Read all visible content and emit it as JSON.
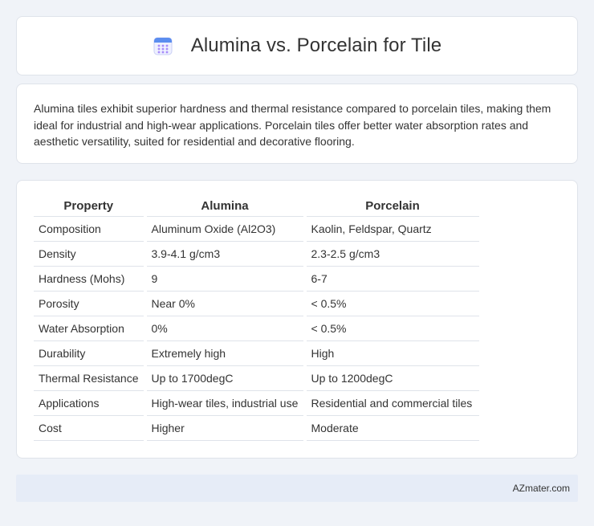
{
  "header": {
    "icon": "calendar-icon",
    "title": "Alumina vs. Porcelain for Tile"
  },
  "summary": {
    "text": "Alumina tiles exhibit superior hardness and thermal resistance compared to porcelain tiles, making them ideal for industrial and high-wear applications. Porcelain tiles offer better water absorption rates and aesthetic versatility, suited for residential and decorative flooring."
  },
  "table": {
    "headers": [
      "Property",
      "Alumina",
      "Porcelain"
    ],
    "rows": [
      [
        "Composition",
        "Aluminum Oxide (Al2O3)",
        "Kaolin, Feldspar, Quartz"
      ],
      [
        "Density",
        "3.9-4.1 g/cm3",
        "2.3-2.5 g/cm3"
      ],
      [
        "Hardness (Mohs)",
        "9",
        "6-7"
      ],
      [
        "Porosity",
        "Near 0%",
        "< 0.5%"
      ],
      [
        "Water Absorption",
        "0%",
        "< 0.5%"
      ],
      [
        "Durability",
        "Extremely high",
        "High"
      ],
      [
        "Thermal Resistance",
        "Up to 1700degC",
        "Up to 1200degC"
      ],
      [
        "Applications",
        "High-wear tiles, industrial use",
        "Residential and commercial tiles"
      ],
      [
        "Cost",
        "Higher",
        "Moderate"
      ]
    ]
  },
  "footer": {
    "text": "AZmater.com"
  },
  "colors": {
    "background": "#f0f3f8",
    "card": "#ffffff",
    "footer_bg": "#e6ecf7",
    "icon_top": "#5b8def",
    "icon_dots": "#a78bfa"
  }
}
